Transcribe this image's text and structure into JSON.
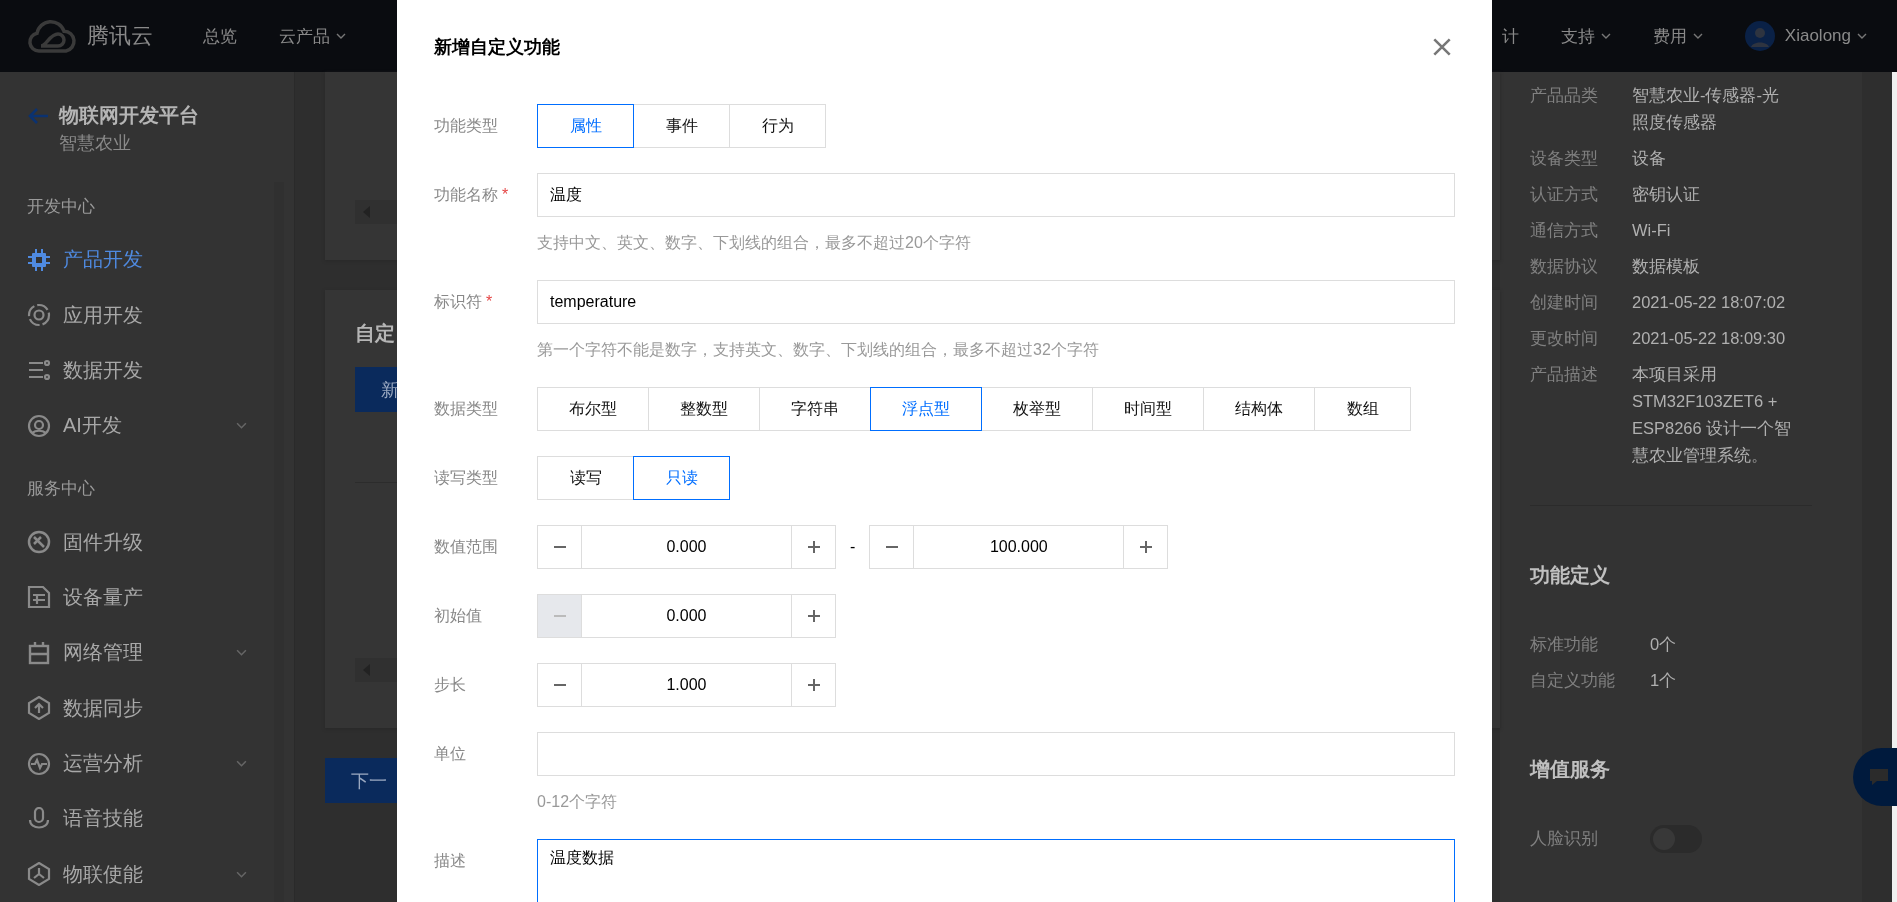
{
  "top_nav": {
    "brand": "腾讯云",
    "left_items": [
      {
        "label": "总览",
        "dropdown": false
      },
      {
        "label": "云产品",
        "dropdown": true
      }
    ],
    "right_items": [
      {
        "label": "计",
        "dropdown": false
      },
      {
        "label": "支持",
        "dropdown": true
      },
      {
        "label": "费用",
        "dropdown": true
      }
    ],
    "user": {
      "name": "Xiaolong",
      "dropdown": true
    }
  },
  "sidebar": {
    "title": "物联网开发平台",
    "subtitle": "智慧农业",
    "sections": [
      {
        "heading": "开发中心",
        "items": [
          {
            "label": "产品开发",
            "selected": true,
            "expandable": false
          },
          {
            "label": "应用开发",
            "selected": false,
            "expandable": false
          },
          {
            "label": "数据开发",
            "selected": false,
            "expandable": false
          },
          {
            "label": "AI开发",
            "selected": false,
            "expandable": true
          }
        ]
      },
      {
        "heading": "服务中心",
        "items": [
          {
            "label": "固件升级",
            "selected": false,
            "expandable": false
          },
          {
            "label": "设备量产",
            "selected": false,
            "expandable": false
          },
          {
            "label": "网络管理",
            "selected": false,
            "expandable": true
          },
          {
            "label": "数据同步",
            "selected": false,
            "expandable": false
          },
          {
            "label": "运营分析",
            "selected": false,
            "expandable": true
          },
          {
            "label": "语音技能",
            "selected": false,
            "expandable": false
          },
          {
            "label": "物联使能",
            "selected": false,
            "expandable": true
          }
        ]
      }
    ]
  },
  "main": {
    "section_title": "自定",
    "new_button": "新",
    "next_button": "下一"
  },
  "product_info": {
    "rows": [
      {
        "label": "产品品类",
        "value": "智慧农业-传感器-光照度传感器"
      },
      {
        "label": "设备类型",
        "value": "设备"
      },
      {
        "label": "认证方式",
        "value": "密钥认证"
      },
      {
        "label": "通信方式",
        "value": "Wi-Fi"
      },
      {
        "label": "数据协议",
        "value": "数据模板"
      },
      {
        "label": "创建时间",
        "value": "2021-05-22 18:07:02"
      },
      {
        "label": "更改时间",
        "value": "2021-05-22 18:09:30"
      },
      {
        "label": "产品描述",
        "value": "本项目采用STM32F103ZET6 + ESP8266 设计一个智慧农业管理系统。"
      }
    ],
    "functions": {
      "heading": "功能定义",
      "rows": [
        {
          "label": "标准功能",
          "value": "0个"
        },
        {
          "label": "自定义功能",
          "value": "1个"
        }
      ]
    },
    "services": {
      "heading": "增值服务",
      "rows": [
        {
          "label": "人脸识别",
          "on": false
        }
      ]
    }
  },
  "dialog": {
    "title": "新增自定义功能",
    "fields": [
      {
        "kind": "segmented",
        "label": "功能类型",
        "options": [
          {
            "label": "属性",
            "selected": true
          },
          {
            "label": "事件",
            "selected": false
          },
          {
            "label": "行为",
            "selected": false
          }
        ]
      },
      {
        "kind": "text",
        "label": "功能名称",
        "required_mark": "*",
        "value": "温度",
        "hint": "支持中文、英文、数字、下划线的组合，最多不超过20个字符"
      },
      {
        "kind": "text",
        "label": "标识符",
        "required_mark": "*",
        "value": "temperature",
        "hint": "第一个字符不能是数字，支持英文、数字、下划线的组合，最多不超过32个字符"
      },
      {
        "kind": "segmented",
        "label": "数据类型",
        "options": [
          {
            "label": "布尔型",
            "selected": false
          },
          {
            "label": "整数型",
            "selected": false
          },
          {
            "label": "字符串",
            "selected": false
          },
          {
            "label": "浮点型",
            "selected": true
          },
          {
            "label": "枚举型",
            "selected": false
          },
          {
            "label": "时间型",
            "selected": false
          },
          {
            "label": "结构体",
            "selected": false
          },
          {
            "label": "数组",
            "selected": false
          }
        ]
      },
      {
        "kind": "segmented",
        "label": "读写类型",
        "options": [
          {
            "label": "读写",
            "selected": false
          },
          {
            "label": "只读",
            "selected": true
          }
        ]
      },
      {
        "kind": "range",
        "label": "数值范围",
        "min": {
          "value": "0.000",
          "minus_disabled": false
        },
        "separator": "-",
        "max": {
          "value": "100.000",
          "minus_disabled": false
        }
      },
      {
        "kind": "stepper",
        "label": "初始值",
        "value": "0.000",
        "minus_disabled": true
      },
      {
        "kind": "stepper",
        "label": "步长",
        "value": "1.000",
        "minus_disabled": false
      },
      {
        "kind": "text",
        "label": "单位",
        "hint": "0-12个字符"
      },
      {
        "kind": "textarea",
        "label": "描述",
        "value": "温度数据",
        "focused": true
      }
    ]
  }
}
